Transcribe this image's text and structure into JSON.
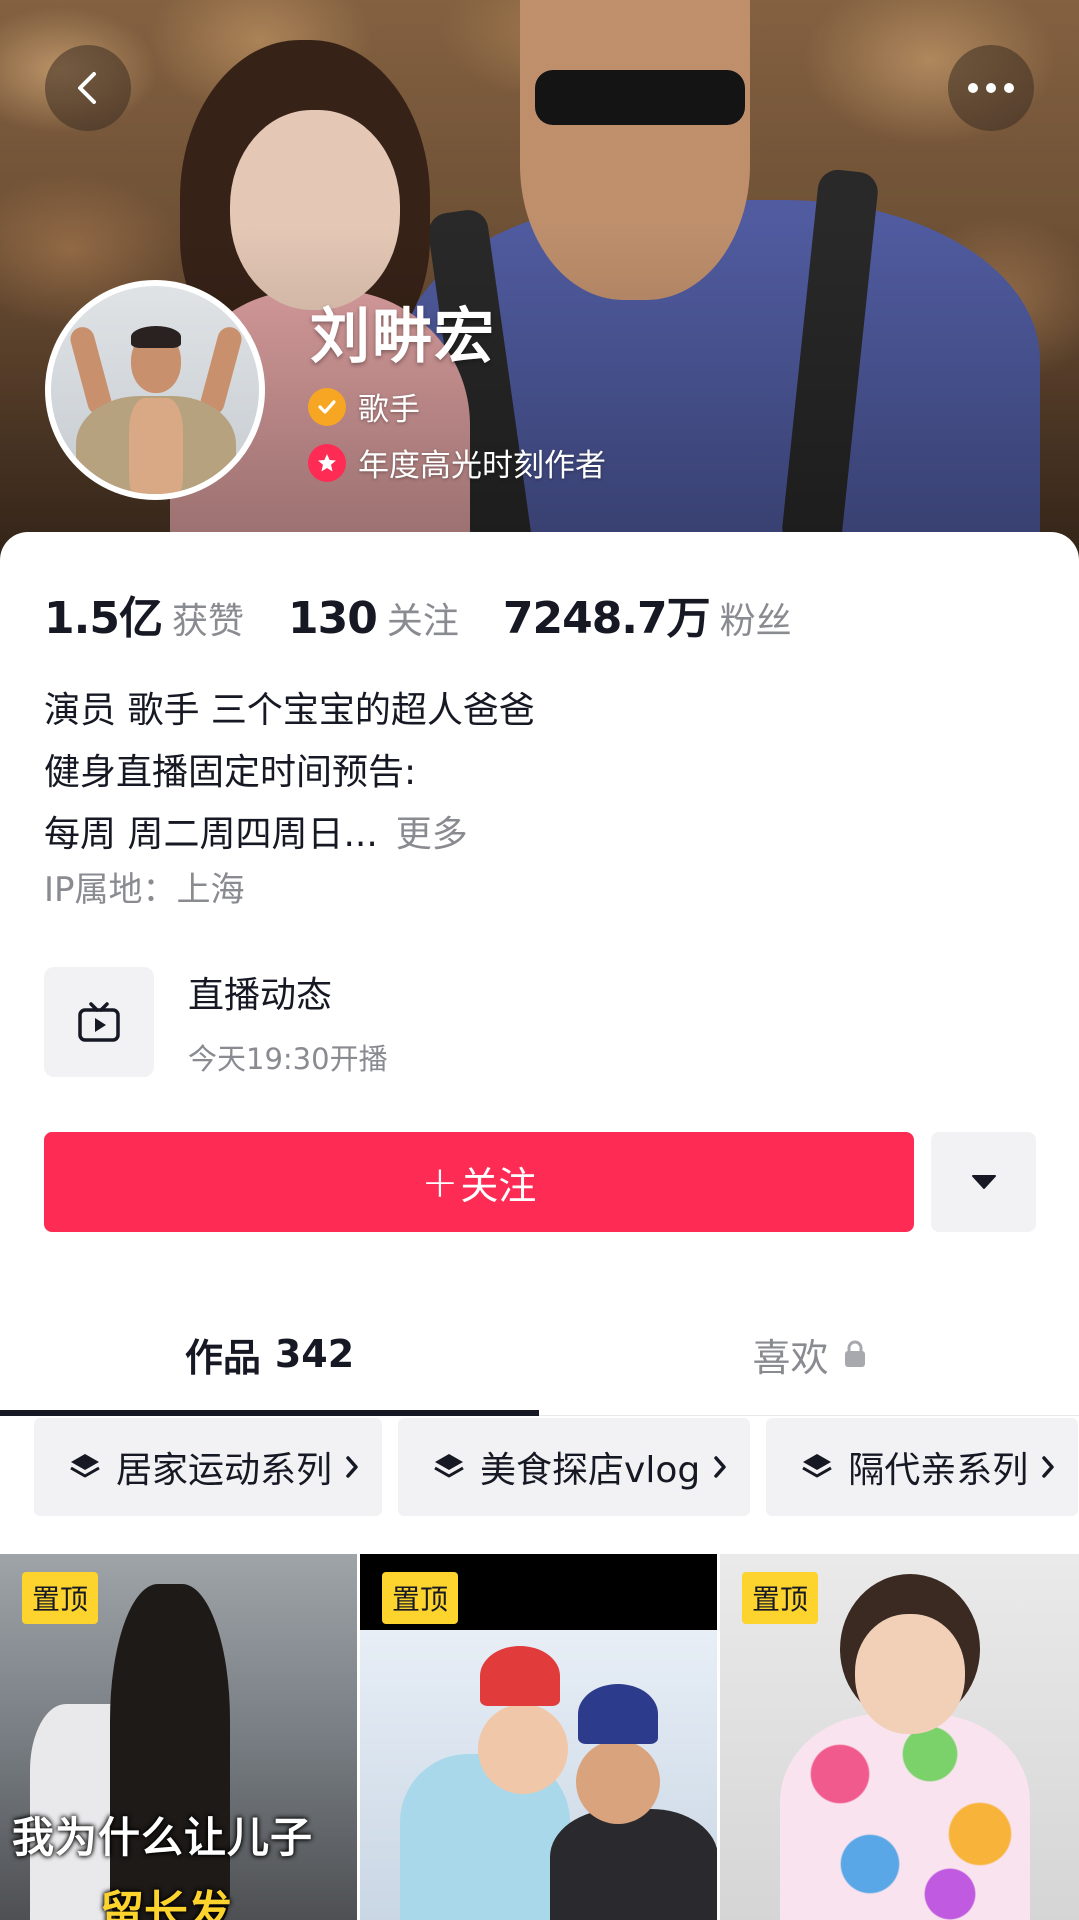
{
  "header": {
    "name": "刘畊宏",
    "verified_tag": "歌手",
    "honor_tag": "年度高光时刻作者"
  },
  "stats": [
    {
      "value": "1.5亿",
      "label": "获赞"
    },
    {
      "value": "130",
      "label": "关注"
    },
    {
      "value": "7248.7万",
      "label": "粉丝"
    }
  ],
  "bio": {
    "line1": "演员 歌手 三个宝宝的超人爸爸",
    "line2": "健身直播固定时间预告:",
    "line3": "每周 周二周四周日...",
    "more": "更多",
    "ip": "IP属地：上海"
  },
  "live": {
    "title": "直播动态",
    "subtitle": "今天19:30开播"
  },
  "actions": {
    "follow_plus": "+",
    "follow_label": "关注"
  },
  "tabs": {
    "works_label": "作品",
    "works_count": "342",
    "likes_label": "喜欢"
  },
  "collections": [
    {
      "label": "居家运动系列"
    },
    {
      "label": "美食探店vlog"
    },
    {
      "label": "隔代亲系列"
    }
  ],
  "videos": [
    {
      "pin": "置顶",
      "caption_line1": "我为什么让儿子",
      "caption_line2": "留长发"
    },
    {
      "pin": "置顶"
    },
    {
      "pin": "置顶"
    }
  ],
  "colors": {
    "accent": "#fe2c55",
    "pin_badge": "#fcd42d",
    "verify_badge": "#f6a623",
    "honor_badge": "#fe2c55"
  },
  "icons": {
    "back": "chevron-left-icon",
    "more": "more-dots-icon",
    "verify": "verified-check-icon",
    "honor": "star-icon",
    "live": "tv-play-icon",
    "dropdown": "caret-down-icon",
    "lock": "lock-icon",
    "collection": "layers-icon",
    "chip_arrow": "chevron-right-icon"
  }
}
